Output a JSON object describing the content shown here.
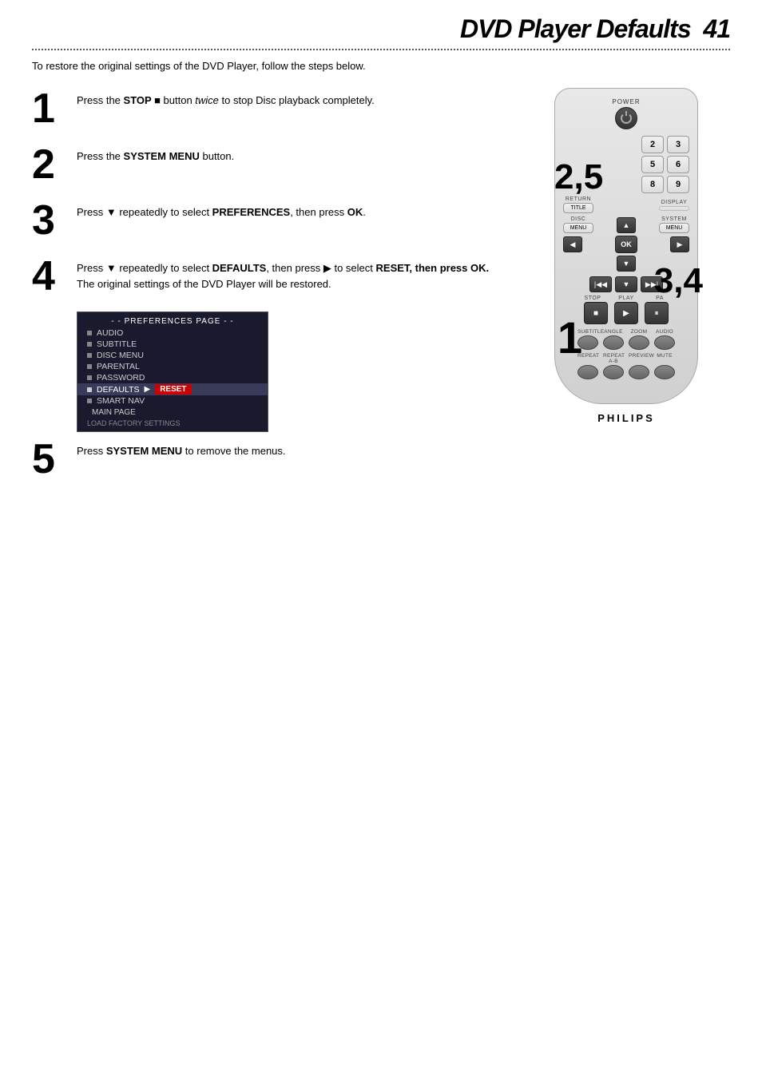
{
  "header": {
    "title": "DVD Player Defaults",
    "page_number": "41"
  },
  "intro": "To restore the original settings of the DVD Player, follow the steps below.",
  "steps": [
    {
      "number": "1",
      "text_html": "Press the <strong>STOP ■</strong> button <em>twice</em> to stop Disc playback completely."
    },
    {
      "number": "2",
      "text_html": "Press the <strong>SYSTEM MENU</strong> button."
    },
    {
      "number": "3",
      "text_html": "Press ▼ repeatedly to select <strong>PREFERENCES</strong>, then press <strong>OK</strong>."
    },
    {
      "number": "4",
      "text_html": "Press ▼ repeatedly to select <strong>DEFAULTS</strong>, then press ▶ to select <strong>RESET, then press OK.</strong> The original settings of the DVD Player will be restored."
    },
    {
      "number": "5",
      "text_html": "Press <strong>SYSTEM MENU</strong> to remove the menus."
    }
  ],
  "menu": {
    "header": "- - PREFERENCES PAGE - -",
    "items": [
      {
        "label": "AUDIO",
        "highlighted": false
      },
      {
        "label": "SUBTITLE",
        "highlighted": false
      },
      {
        "label": "DISC MENU",
        "highlighted": false
      },
      {
        "label": "PARENTAL",
        "highlighted": false
      },
      {
        "label": "PASSWORD",
        "highlighted": false
      },
      {
        "label": "DEFAULTS",
        "highlighted": true,
        "has_arrow": true,
        "has_reset": true
      },
      {
        "label": "SMART NAV",
        "highlighted": false
      }
    ],
    "footer_label": "MAIN PAGE",
    "load_text": "LOAD FACTORY SETTINGS"
  },
  "remote": {
    "power_label": "POWER",
    "numbers": [
      [
        "2",
        "3"
      ],
      [
        "5",
        "6"
      ],
      [
        "8",
        "9"
      ]
    ],
    "return_label": "RETURN",
    "title_label": "TITLE",
    "disc_label": "DISC",
    "menu_label": "MENU",
    "system_label": "SYSTEM",
    "ok_label": "OK",
    "stop_label": "STOP",
    "play_label": "PLAY",
    "pause_label": "PA",
    "subtitle_label": "SUBTITLE",
    "angle_label": "ANGLE",
    "zoom_label": "ZOOM",
    "audio_label": "AUDIO",
    "repeat_label": "REPEAT",
    "repeat_ab_label": "REPEAT\nA-B",
    "preview_label": "PREVIEW",
    "mute_label": "MUTE",
    "brand": "PHILIPS",
    "step_labels": {
      "label_25": "2,5",
      "label_34": "3,4",
      "label_1": "1"
    }
  }
}
